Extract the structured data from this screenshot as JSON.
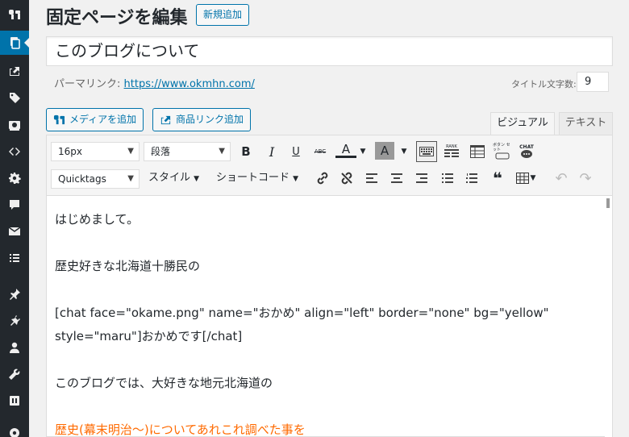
{
  "header": {
    "title": "固定ページを編集",
    "add_new": "新規追加"
  },
  "post": {
    "title": "このブログについて",
    "permalink_label": "パーマリンク:",
    "permalink_url": "https://www.okmhn.com/",
    "char_count_label": "タイトル文字数:",
    "char_count": "9"
  },
  "media_buttons": {
    "add_media": "メディアを追加",
    "add_product_link": "商品リンク追加"
  },
  "tabs": {
    "visual": "ビジュアル",
    "text": "テキスト"
  },
  "toolbar": {
    "font_size": "16px",
    "paragraph": "段落",
    "quicktags": "Quicktags",
    "style": "スタイル",
    "shortcode": "ショートコード",
    "bold": "B",
    "italic": "I",
    "underline": "U",
    "strikethrough": "ABC",
    "font_color": "A",
    "bg_color": "A",
    "rank": "RANK",
    "button_set": "ボタン セット",
    "chat": "CHAT"
  },
  "content": {
    "lines": [
      "はじめまして。",
      "",
      "歴史好きな北海道十勝民の",
      "",
      "[chat face=\"okame.png\" name=\"おかめ\" align=\"left\" border=\"none\" bg=\"yellow\"",
      "style=\"maru\"]おかめです[/chat]",
      "",
      "このブログでは、大好きな地元北海道の",
      "",
      "歴史(幕末明治〜)についてあれこれ調べた事を"
    ]
  },
  "colors": {
    "sidebar": "#23282d",
    "accent": "#0073aa",
    "orange_text": "#ff6a00"
  },
  "sidebar_icons": [
    "analytics-icon",
    "pages-icon",
    "export-icon",
    "tag-icon",
    "camera-icon",
    "code-icon",
    "gear-icon",
    "comment-icon",
    "mail-icon",
    "list-icon",
    "pin-icon",
    "plugin-icon",
    "user-icon",
    "wrench-icon",
    "settings-icon",
    "gear-icon"
  ]
}
